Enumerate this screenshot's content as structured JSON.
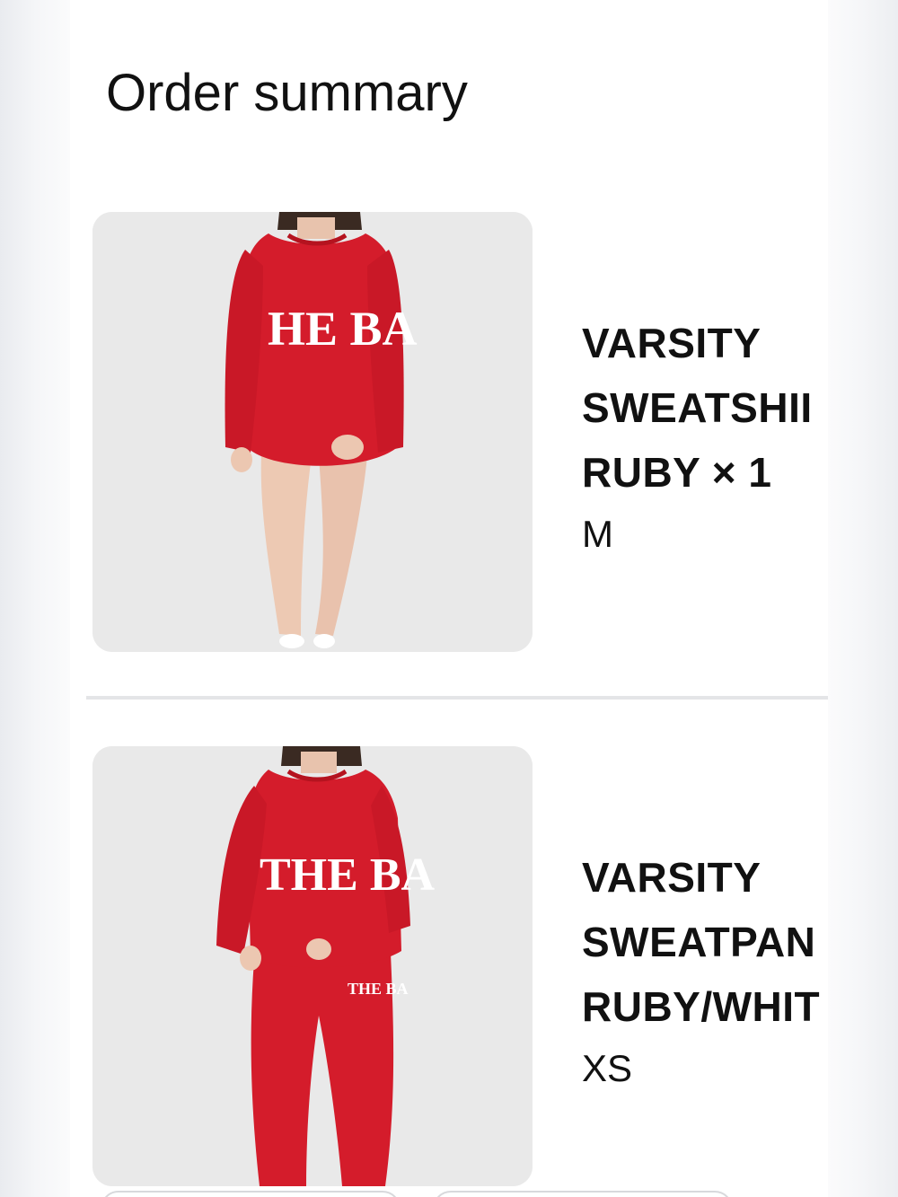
{
  "order_summary": {
    "title": "Order summary",
    "items": [
      {
        "name_lines": [
          "VARSITY",
          "SWEATSHII",
          "RUBY × 1"
        ],
        "variant": "M",
        "image_alt": "red-sweatshirt-product-image",
        "print_text": "HE BA"
      },
      {
        "name_lines": [
          "VARSITY",
          "SWEATPAN",
          "RUBY/WHIT"
        ],
        "variant": "XS",
        "image_alt": "red-sweatpants-product-image",
        "print_text": "THE BA"
      }
    ]
  },
  "colors": {
    "product_red": "#d41c2b",
    "thumb_bg": "#e9e9e9",
    "divider": "#e4e5e7",
    "text": "#111111"
  }
}
